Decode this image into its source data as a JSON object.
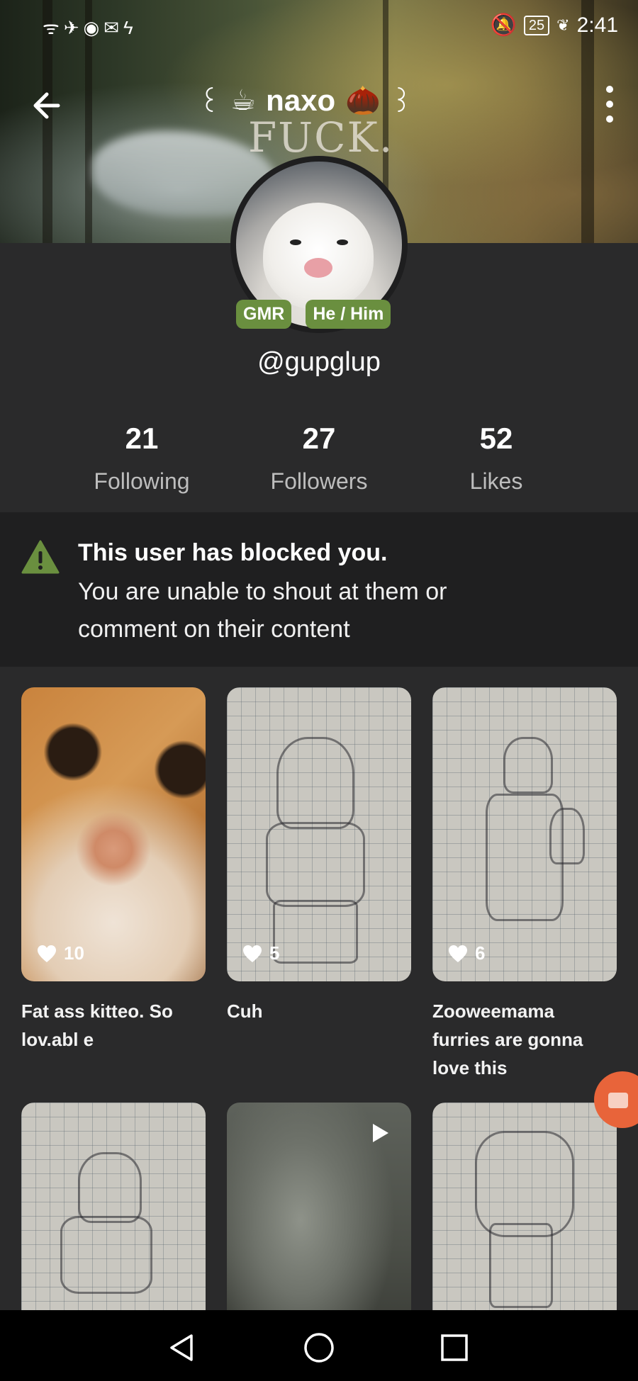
{
  "status_bar": {
    "left_icons": [
      "wifi-icon",
      "airplane-icon",
      "rec-icon",
      "mail-icon",
      "bolt-icon"
    ],
    "battery": "25",
    "time": "2:41"
  },
  "banner": {
    "overlay_text": "FUCK."
  },
  "header": {
    "title": "naxo",
    "deco_left": "꒰",
    "deco_right": "꒱",
    "emoji_left": "☕",
    "emoji_right": "🌰"
  },
  "profile": {
    "badges": [
      "GMR",
      "He / Him"
    ],
    "username": "@gupglup"
  },
  "stats": [
    {
      "value": "21",
      "label": "Following"
    },
    {
      "value": "27",
      "label": "Followers"
    },
    {
      "value": "52",
      "label": "Likes"
    }
  ],
  "blocked_notice": {
    "title": "This user has blocked you.",
    "message": "You are unable to shout at them or comment on their content"
  },
  "posts": [
    {
      "likes": "10",
      "caption": "Fat ass kitteo. So lov.abl e"
    },
    {
      "likes": "5",
      "caption": "Cuh"
    },
    {
      "likes": "6",
      "caption": "Zooweemama furries are gonna love this"
    },
    {
      "likes": "",
      "caption": ""
    },
    {
      "likes": "",
      "caption": ""
    },
    {
      "likes": "",
      "caption": ""
    }
  ],
  "colors": {
    "background": "#2a2a2b",
    "notice_bg": "#1f1f20",
    "badge_green": "#6a8f3f",
    "warning_green": "#6a8f3f",
    "fab_orange": "#e8643a"
  }
}
